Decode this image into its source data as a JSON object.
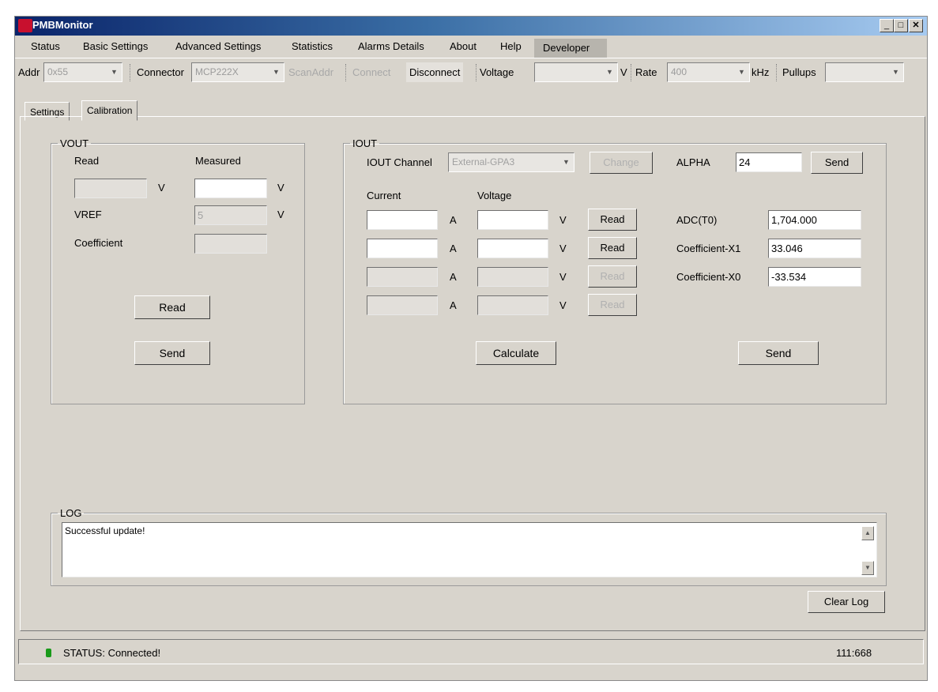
{
  "window": {
    "title": "PMBMonitor"
  },
  "menubar": {
    "items": [
      "Status",
      "Basic Settings",
      "Advanced Settings",
      "Statistics",
      "Alarms Details",
      "About",
      "Help",
      "Developer"
    ]
  },
  "toolbar": {
    "addr_label": "Addr",
    "addr_value": "0x55",
    "connector_label": "Connector",
    "connector_value": "MCP222X",
    "scanaddr": "ScanAddr",
    "connect": "Connect",
    "disconnect": "Disconnect",
    "voltage_label": "Voltage",
    "voltage_value": "",
    "voltage_unit": "V",
    "rate_label": "Rate",
    "rate_value": "400",
    "rate_unit": "kHz",
    "pullups_label": "Pullups",
    "pullups_value": ""
  },
  "tabs": [
    "Settings",
    "Calibration"
  ],
  "vout": {
    "legend": "VOUT",
    "read_header": "Read",
    "measured_header": "Measured",
    "read_value": "",
    "read_unit": "V",
    "measured_value": "",
    "measured_unit": "V",
    "vref_label": "VREF",
    "vref_value": "5",
    "vref_unit": "V",
    "coefficient_label": "Coefficient",
    "coefficient_value": "",
    "read_button": "Read",
    "send_button": "Send"
  },
  "iout": {
    "legend": "IOUT",
    "channel_label": "IOUT Channel",
    "channel_value": "External-GPA3",
    "change_button": "Change",
    "alpha_label": "ALPHA",
    "alpha_value": "24",
    "alpha_send": "Send",
    "current_header": "Current",
    "voltage_header": "Voltage",
    "rows": [
      {
        "current": "",
        "a": "A",
        "voltage": "",
        "v": "V",
        "read": "Read"
      },
      {
        "current": "",
        "a": "A",
        "voltage": "",
        "v": "V",
        "read": "Read"
      },
      {
        "current": "",
        "a": "A",
        "voltage": "",
        "v": "V",
        "read": "Read"
      },
      {
        "current": "",
        "a": "A",
        "voltage": "",
        "v": "V",
        "read": "Read"
      }
    ],
    "adc_label": "ADC(T0)",
    "adc_value": "1,704.000",
    "cx1_label": "Coefficient-X1",
    "cx1_value": "33.046",
    "cx0_label": "Coefficient-X0",
    "cx0_value": "-33.534",
    "calculate_button": "Calculate",
    "send_button": "Send"
  },
  "log": {
    "legend": "LOG",
    "text": "Successful update!",
    "clear_button": "Clear Log"
  },
  "status": {
    "text": "STATUS: Connected!",
    "counter": "111:668",
    "led_color": "#1a9a1a"
  }
}
